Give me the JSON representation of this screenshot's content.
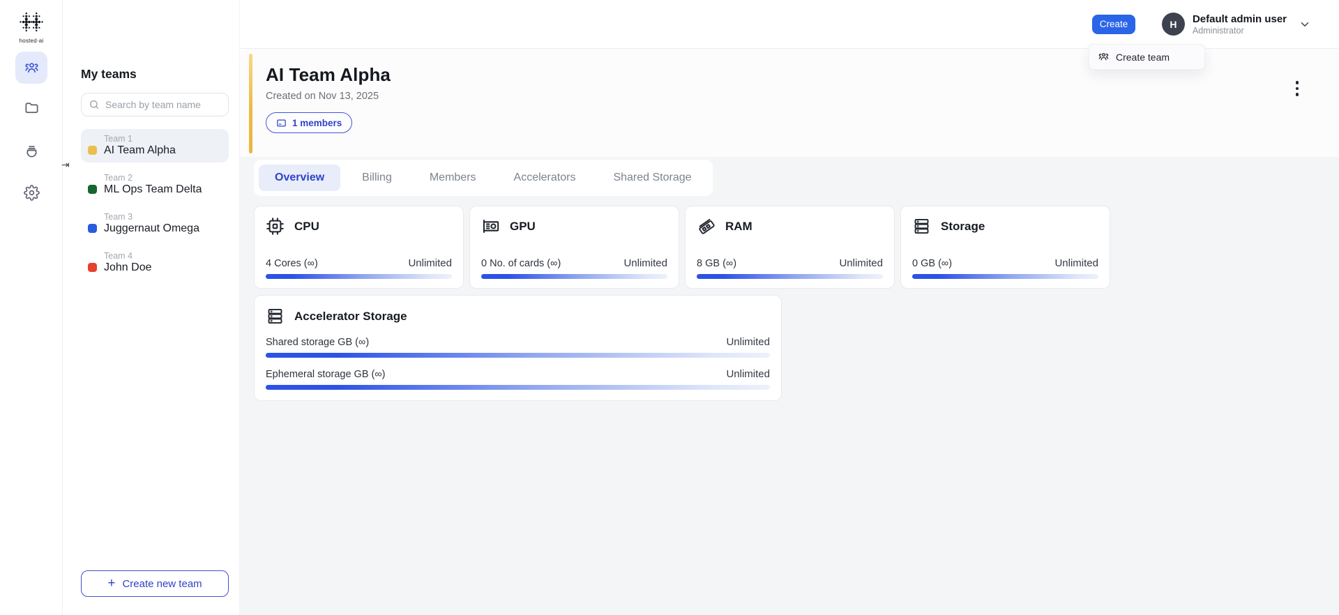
{
  "brand": {
    "logo_text": "hosted·ai"
  },
  "nav": {
    "collapse_glyph": "⇥"
  },
  "teams_panel": {
    "title": "My teams",
    "search_placeholder": "Search by team name",
    "teams": [
      {
        "label": "Team 1",
        "name": "AI Team Alpha",
        "color": "#ECBE4E"
      },
      {
        "label": "Team 2",
        "name": "ML Ops Team Delta",
        "color": "#17652F"
      },
      {
        "label": "Team 3",
        "name": "Juggernaut Omega",
        "color": "#2A5BE0"
      },
      {
        "label": "Team 4",
        "name": "John Doe",
        "color": "#E6402E"
      }
    ],
    "create_plus": "+",
    "create_button": "Create new team"
  },
  "topbar": {
    "create_label": "Create",
    "user": {
      "initial": "H",
      "name": "Default admin user",
      "role": "Administrator"
    }
  },
  "create_menu": {
    "items": [
      {
        "label": "Create team"
      }
    ]
  },
  "page": {
    "title": "AI Team Alpha",
    "created": "Created on Nov 13, 2025",
    "members_badge": "1 members",
    "accent_color": "#EDBB45"
  },
  "tabs": [
    {
      "label": "Overview",
      "active": true
    },
    {
      "label": "Billing",
      "active": false
    },
    {
      "label": "Members",
      "active": false
    },
    {
      "label": "Accelerators",
      "active": false
    },
    {
      "label": "Shared Storage",
      "active": false
    }
  ],
  "resources": {
    "cards": [
      {
        "title": "CPU",
        "value": "4 Cores (∞)",
        "limit": "Unlimited"
      },
      {
        "title": "GPU",
        "value": "0 No. of cards (∞)",
        "limit": "Unlimited"
      },
      {
        "title": "RAM",
        "value": "8 GB (∞)",
        "limit": "Unlimited"
      },
      {
        "title": "Storage",
        "value": "0 GB (∞)",
        "limit": "Unlimited"
      }
    ],
    "accelerator": {
      "title": "Accelerator Storage",
      "rows": [
        {
          "label": "Shared storage GB (∞)",
          "limit": "Unlimited"
        },
        {
          "label": "Ephemeral storage GB (∞)",
          "limit": "Unlimited"
        }
      ]
    }
  },
  "colors": {
    "primary_blue": "#2A64E8",
    "bar_gradient_start": "#2C52E8",
    "bar_gradient_end": "#EDF1FC",
    "active_tab_bg": "#E9ECF9"
  }
}
